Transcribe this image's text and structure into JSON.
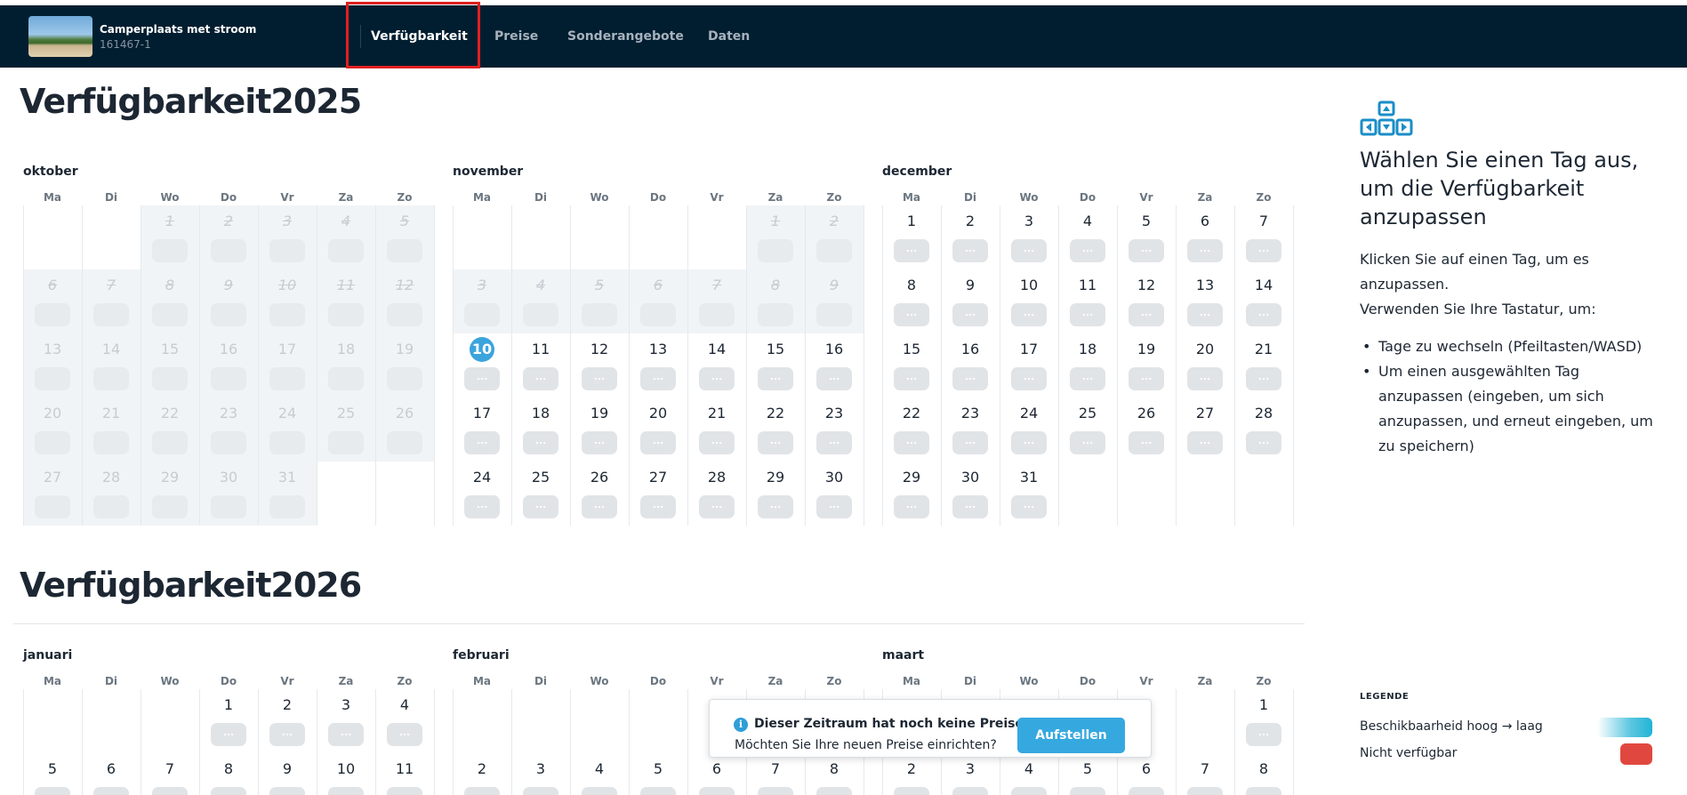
{
  "header": {
    "property_name": "Camperplaats met stroom",
    "property_id": "161467-1",
    "tabs": [
      {
        "label": "Verfügbarkeit",
        "active": true
      },
      {
        "label": "Preise",
        "active": false
      },
      {
        "label": "Sonderangebote",
        "active": false
      },
      {
        "label": "Daten",
        "active": false
      }
    ]
  },
  "weekdays": [
    "Ma",
    "Di",
    "Wo",
    "Do",
    "Vr",
    "Za",
    "Zo"
  ],
  "pill_placeholder": "...",
  "years": [
    {
      "title": "Verfügbarkeit2025",
      "months": [
        {
          "name": "oktober",
          "first_weekday": 2,
          "days": 31,
          "past_through": 31,
          "availability": {
            "1": "",
            "2": "",
            "3": "",
            "4": "",
            "5": "",
            "1b": ""
          }
        },
        {
          "name": "november",
          "first_weekday": 5,
          "days": 30,
          "past_through": 9,
          "today": 10
        },
        {
          "name": "december",
          "first_weekday": 0,
          "days": 31,
          "past_through": 0
        }
      ],
      "october_availability": [
        7,
        8,
        8,
        8,
        8,
        8,
        8,
        8,
        8,
        8,
        8,
        8
      ]
    },
    {
      "title": "Verfügbarkeit2026",
      "months": [
        {
          "name": "januari",
          "first_weekday": 3,
          "days": 31,
          "past_through": 0
        },
        {
          "name": "februari",
          "first_weekday": 6,
          "days": 28,
          "past_through": 0
        },
        {
          "name": "maart",
          "first_weekday": 6,
          "days": 31,
          "past_through": 0
        }
      ]
    }
  ],
  "panel": {
    "title": "Wählen Sie einen Tag aus, um die Verfügbarkeit anzupassen",
    "text_1": "Klicken Sie auf einen Tag, um es anzupassen.",
    "text_2": "Verwenden Sie Ihre Tastatur, um:",
    "list": [
      "Tage zu wechseln (Pfeiltasten/WASD)",
      "Um einen ausgewählten Tag anzupassen (eingeben, um sich anzupassen, und erneut eingeben, um zu speichern)"
    ]
  },
  "legend": {
    "title": "LEGENDE",
    "items": [
      {
        "label": "Beschikbaarheid hoog → laag",
        "icon": "gradient-swatch"
      },
      {
        "label": "Nicht verfügbar",
        "icon": "red-swatch"
      }
    ]
  },
  "notice": {
    "title": "Dieser Zeitraum hat noch keine Preise",
    "text": "Möchten Sie Ihre neuen Preise einrichten?",
    "button": "Aufstellen",
    "icon": "info-icon"
  },
  "colors": {
    "header_bg": "#011e30",
    "accent": "#36a8e0",
    "unavailable": "#e0483f",
    "highlight_box": "#e02020"
  }
}
